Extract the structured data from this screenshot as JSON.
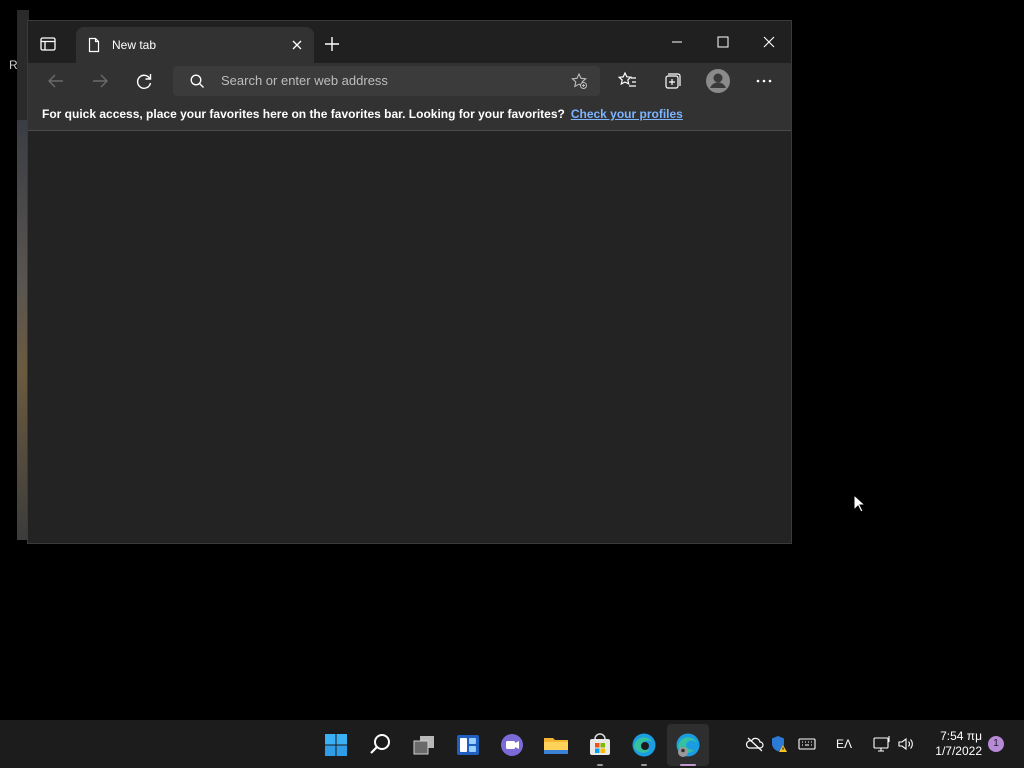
{
  "background_window": {
    "partial_text": "R"
  },
  "browser": {
    "tab": {
      "title": "New tab",
      "close_label": "Close tab"
    },
    "new_tab_label": "New tab",
    "window_controls": {
      "minimize": "Minimize",
      "maximize": "Maximize",
      "close": "Close"
    },
    "address_bar": {
      "placeholder": "Search or enter web address",
      "value": ""
    },
    "favorites_bar": {
      "message": "For quick access, place your favorites here on the favorites bar. Looking for your favorites?",
      "link": "Check your profiles"
    }
  },
  "taskbar": {
    "apps": [
      "start-icon",
      "search-icon",
      "task-view-icon",
      "widgets-icon",
      "chat-icon",
      "file-explorer-icon",
      "store-icon",
      "edge-icon",
      "edge-profile-icon"
    ],
    "language": "ΕΛ",
    "clock": {
      "time": "7:54 πμ",
      "date": "1/7/2022"
    },
    "notification_count": "1"
  },
  "colors": {
    "accent": "#7cb4ff",
    "taskbar": "#1c1c1c",
    "browser_bg": "#202020",
    "toolbar": "#323232"
  }
}
